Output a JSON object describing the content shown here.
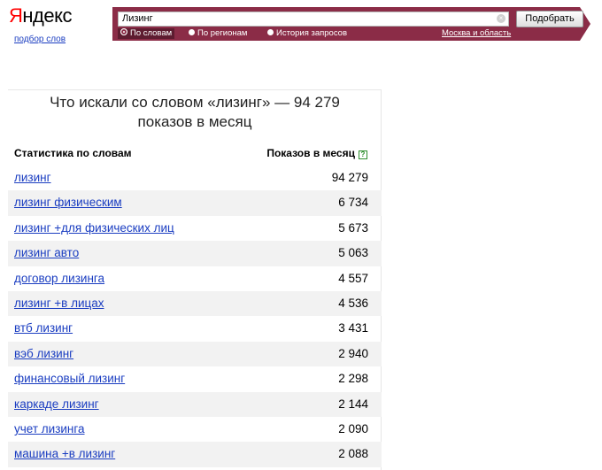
{
  "header": {
    "logo_first_letter": "Я",
    "logo_rest": "ндекс",
    "logo_subtitle": "подбор слов",
    "search": {
      "query": "Лизинг",
      "button_label": "Подобрать",
      "clear_icon": "×",
      "radio_options": [
        {
          "label": "По словам",
          "selected": true
        },
        {
          "label": "По регионам",
          "selected": false
        },
        {
          "label": "История запросов",
          "selected": false
        }
      ],
      "region_link": "Москва и область"
    },
    "accent_color": "#8b2c47"
  },
  "panel": {
    "title_line1": "Что искали со словом «лизинг» — 94 279",
    "title_line2": "показов в месяц",
    "col_words": "Статистика по словам",
    "col_shows": "Показов в месяц",
    "help_icon": "?",
    "rows": [
      {
        "keyword": "лизинг",
        "count": "94 279"
      },
      {
        "keyword": "лизинг физическим",
        "count": "6 734"
      },
      {
        "keyword": "лизинг +для физических лиц",
        "count": "5 673"
      },
      {
        "keyword": "лизинг авто",
        "count": "5 063"
      },
      {
        "keyword": "договор лизинга",
        "count": "4 557"
      },
      {
        "keyword": "лизинг +в лицах",
        "count": "4 536"
      },
      {
        "keyword": "втб лизинг",
        "count": "3 431"
      },
      {
        "keyword": "вэб лизинг",
        "count": "2 940"
      },
      {
        "keyword": "финансовый лизинг",
        "count": "2 298"
      },
      {
        "keyword": "каркаде лизинг",
        "count": "2 144"
      },
      {
        "keyword": "учет лизинга",
        "count": "2 090"
      },
      {
        "keyword": "машина +в лизинг",
        "count": "2 088"
      }
    ]
  }
}
